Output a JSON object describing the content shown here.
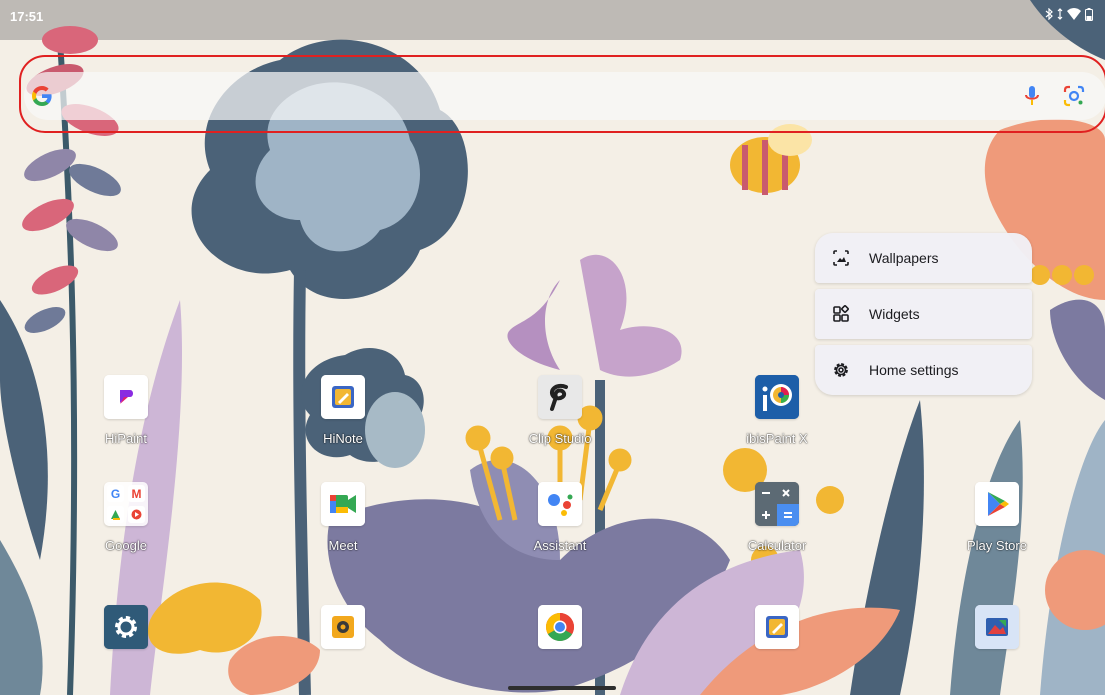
{
  "status_bar": {
    "time": "17:51",
    "icons": [
      "bluetooth-icon",
      "data-arrows-icon",
      "wifi-icon",
      "battery-icon"
    ]
  },
  "search_bar": {
    "logo": "google-g-icon",
    "mic_icon": "mic-icon",
    "lens_icon": "google-lens-icon",
    "highlight_color": "#e02020"
  },
  "context_menu": {
    "items": [
      {
        "label": "Wallpapers",
        "icon": "wallpaper-icon"
      },
      {
        "label": "Widgets",
        "icon": "widgets-icon"
      },
      {
        "label": "Home settings",
        "icon": "gear-icon"
      }
    ]
  },
  "apps": {
    "row1": [
      {
        "label": "HiPaint",
        "icon": "hipaint-icon"
      },
      {
        "label": "HiNote",
        "icon": "hinote-icon"
      },
      {
        "label": "Clip Studio",
        "icon": "clip-studio-icon"
      },
      {
        "label": "ibisPaint X",
        "icon": "ibispaint-icon"
      }
    ],
    "row2": [
      {
        "label": "Google",
        "icon": "google-folder-icon"
      },
      {
        "label": "Meet",
        "icon": "meet-icon"
      },
      {
        "label": "Assistant",
        "icon": "assistant-icon"
      },
      {
        "label": "Calculator",
        "icon": "calculator-icon"
      },
      {
        "label": "Play Store",
        "icon": "play-store-icon"
      }
    ],
    "dock": [
      {
        "icon": "settings-icon"
      },
      {
        "icon": "camera-app-icon"
      },
      {
        "icon": "chrome-icon"
      },
      {
        "icon": "notes-app-icon"
      },
      {
        "icon": "gallery-app-icon"
      }
    ]
  },
  "colors": {
    "wallpaper_bg": "#f4efe6",
    "menu_bg": "#f1f0f5"
  }
}
